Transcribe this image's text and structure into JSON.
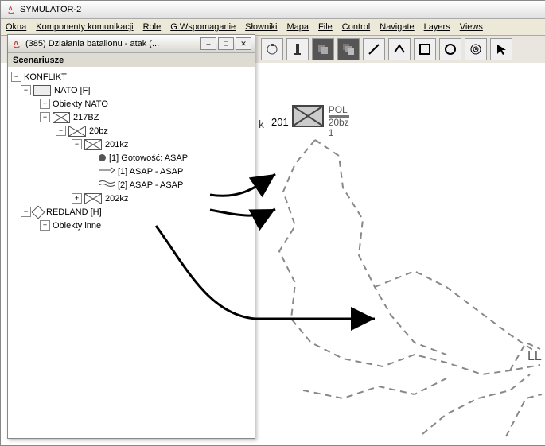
{
  "app": {
    "title": "SYMULATOR-2"
  },
  "menu": {
    "okna": "Okna",
    "komponenty": "Komponenty komunikacji",
    "role": "Role",
    "wspomaganie": "G:Wspomaganie",
    "slowniki": "Słowniki",
    "mapa": "Mapa",
    "file": "File",
    "control": "Control",
    "navigate": "Navigate",
    "layers": "Layers",
    "views": "Views"
  },
  "floatwin": {
    "title": "(385) Działania batalionu - atak (...",
    "panel": "Scenariusze"
  },
  "tree": {
    "root": "KONFLIKT",
    "nato": "NATO [F]",
    "nato_obj": "Obiekty NATO",
    "bz": "217BZ",
    "b20": "20bz",
    "k201": "201kz",
    "ready": "[1] Gotowość:  ASAP",
    "asap1": "[1]  ASAP -  ASAP",
    "asap2": "[2]  ASAP -  ASAP",
    "k202": "202kz",
    "red": "REDLAND [H]",
    "other": "Obiekty inne"
  },
  "mapunit": {
    "left": "201",
    "topLabel": "POL",
    "mid": "20bz",
    "bot": "1",
    "cutLabel": "LL",
    "truncK": "k"
  },
  "icons": {
    "decal": "decal",
    "marker": "marker",
    "stack1": "stack",
    "stack2": "stack",
    "line": "line",
    "roof": "roof",
    "square": "square",
    "circle": "circle",
    "target": "target",
    "cursor": "cursor"
  }
}
